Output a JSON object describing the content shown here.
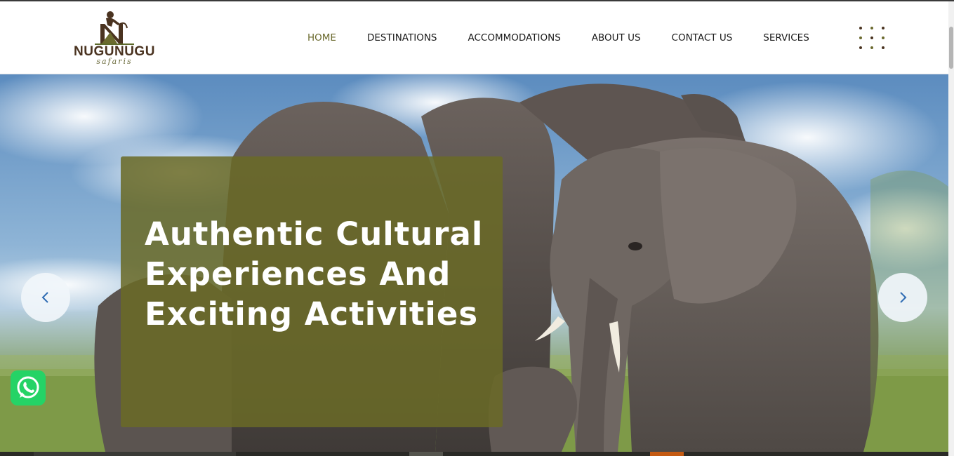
{
  "logo": {
    "name": "NUGUNUGU",
    "sub": "safaris"
  },
  "nav": {
    "items": [
      {
        "label": "HOME",
        "active": true
      },
      {
        "label": "DESTINATIONS",
        "active": false
      },
      {
        "label": "ACCOMMODATIONS",
        "active": false
      },
      {
        "label": "ABOUT US",
        "active": false
      },
      {
        "label": "CONTACT US",
        "active": false
      },
      {
        "label": "SERVICES",
        "active": false
      }
    ]
  },
  "menu_dots": {
    "colors": [
      "#4a3320",
      "#6b6a2e",
      "#4a3320",
      "#6b6a2e",
      "#4a3320",
      "#6b6a2e",
      "#4a3320",
      "#6b6a2e",
      "#4a3320"
    ]
  },
  "hero": {
    "heading": "Authentic Cultural Experiences And Exciting Activities",
    "prev_icon": "chevron-left-icon",
    "next_icon": "chevron-right-icon"
  },
  "whatsapp": {
    "icon": "whatsapp-icon"
  },
  "colors": {
    "accent": "#6b6a2e",
    "caption_bg": "#6a6a26",
    "whatsapp": "#25d366"
  }
}
